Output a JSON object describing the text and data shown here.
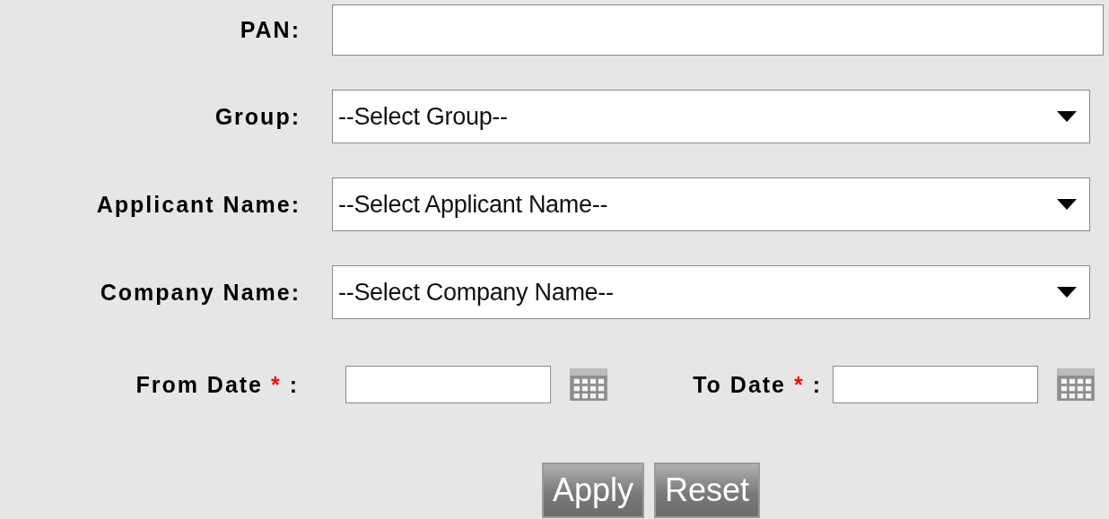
{
  "fields": [
    {
      "label": "PAN:",
      "kind": "text"
    },
    {
      "label": "Group:",
      "kind": "select",
      "value": "--Select Group--"
    },
    {
      "label": "Applicant Name:",
      "kind": "select",
      "value": "--Select Applicant Name--"
    },
    {
      "label": "Company Name:",
      "kind": "select",
      "value": "--Select Company Name--"
    }
  ],
  "date_fields": [
    {
      "label": "From Date",
      "required_mark": "*",
      "separator": ":"
    },
    {
      "label": "To Date",
      "required_mark": "*",
      "separator": ":"
    }
  ],
  "buttons": [
    "Apply",
    "Reset"
  ]
}
